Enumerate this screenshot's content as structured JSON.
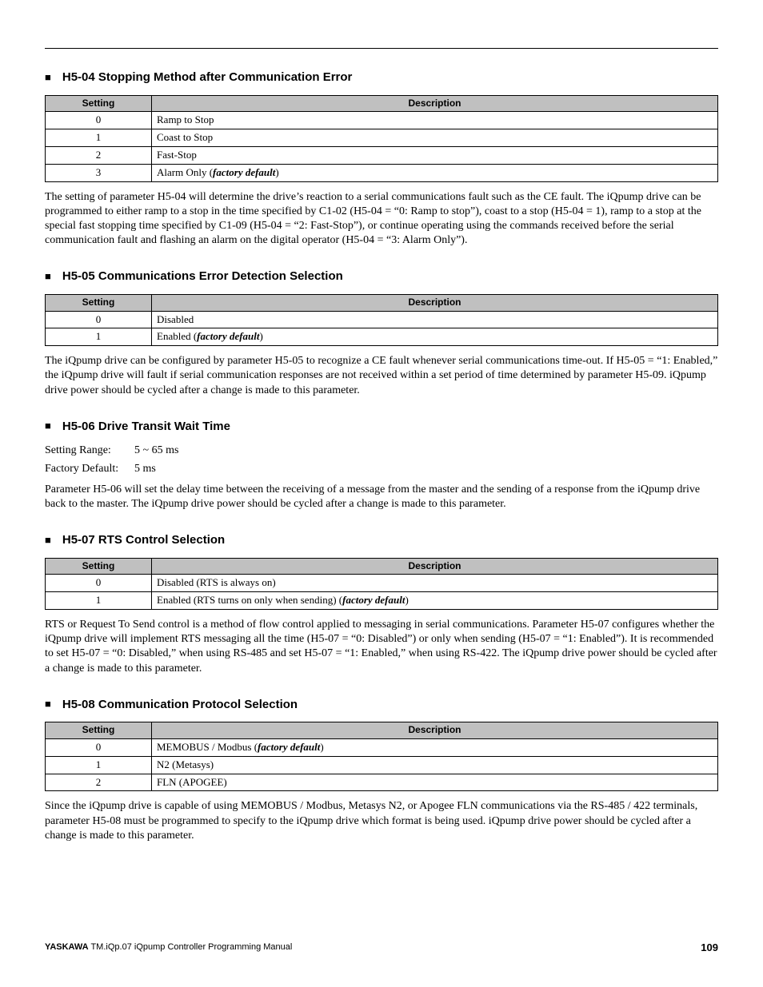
{
  "sections": {
    "h5_04": {
      "title": "H5-04 Stopping Method after Communication Error",
      "headers": {
        "setting": "Setting",
        "description": "Description"
      },
      "rows": [
        {
          "setting": "0",
          "desc": "Ramp to Stop"
        },
        {
          "setting": "1",
          "desc": "Coast to Stop"
        },
        {
          "setting": "2",
          "desc": "Fast-Stop"
        },
        {
          "setting": "3",
          "desc_prefix": "Alarm Only (",
          "desc_default": "factory default",
          "desc_suffix": ")"
        }
      ],
      "para": "The setting of parameter H5-04 will determine the drive’s reaction to a serial communications fault such as the CE fault. The iQpump drive can be programmed to either ramp to a stop in the time specified by C1-02 (H5-04 = “0: Ramp to stop”), coast to a stop (H5-04 = 1), ramp to a stop at the special fast stopping time specified by C1-09 (H5-04 = “2: Fast-Stop”), or continue operating using the commands received before the serial communication fault and flashing an alarm on the digital operator (H5-04 = “3: Alarm Only”)."
    },
    "h5_05": {
      "title": "H5-05 Communications Error Detection Selection",
      "headers": {
        "setting": "Setting",
        "description": "Description"
      },
      "rows": [
        {
          "setting": "0",
          "desc": "Disabled"
        },
        {
          "setting": "1",
          "desc_prefix": "Enabled (",
          "desc_default": "factory default",
          "desc_suffix": ")"
        }
      ],
      "para": "The iQpump drive can be configured by parameter H5-05 to recognize a CE fault whenever serial communications time-out. If H5-05 = “1: Enabled,” the iQpump drive will fault if serial communication responses are not received within a set period of time determined by parameter H5-09. iQpump drive power should be cycled after a change is made to this parameter."
    },
    "h5_06": {
      "title": "H5-06 Drive Transit Wait Time",
      "setting_range_label": "Setting Range:",
      "setting_range_value": "5 ~ 65 ms",
      "factory_default_label": "Factory Default:",
      "factory_default_value": "5 ms",
      "para": "Parameter H5-06 will set the delay time between the receiving of a message from the master and the sending of a response from the iQpump drive back to the master. The iQpump drive power should be cycled after a change is made to this parameter."
    },
    "h5_07": {
      "title": "H5-07 RTS Control Selection",
      "headers": {
        "setting": "Setting",
        "description": "Description"
      },
      "rows": [
        {
          "setting": "0",
          "desc": "Disabled (RTS is always on)"
        },
        {
          "setting": "1",
          "desc_prefix": "Enabled (RTS turns on only when sending) (",
          "desc_default": "factory default",
          "desc_suffix": ")"
        }
      ],
      "para": "RTS or Request To Send control is a method of flow control applied to messaging in serial communications. Parameter H5-07 configures whether the iQpump drive will implement RTS messaging all the time (H5-07 = “0: Disabled”) or only when sending (H5-07 = “1: Enabled”). It is recommended to set H5-07 = “0: Disabled,” when using RS-485 and set H5-07 = “1: Enabled,” when using RS-422. The iQpump drive power should be cycled after a change is made to this parameter."
    },
    "h5_08": {
      "title": "H5-08 Communication Protocol Selection",
      "headers": {
        "setting": "Setting",
        "description": "Description"
      },
      "rows": [
        {
          "setting": "0",
          "desc_prefix": "MEMOBUS / Modbus (",
          "desc_default": "factory default",
          "desc_suffix": ")"
        },
        {
          "setting": "1",
          "desc": "N2 (Metasys)"
        },
        {
          "setting": "2",
          "desc": "FLN (APOGEE)"
        }
      ],
      "para": "Since the iQpump drive is capable of using MEMOBUS / Modbus, Metasys N2, or Apogee FLN communications via the RS-485 / 422 terminals, parameter H5-08 must be programmed to specify to the iQpump drive which format is being used. iQpump drive power should be cycled after a change is made to this parameter."
    }
  },
  "footer": {
    "brand": "YASKAWA",
    "doc": " TM.iQp.07 iQpump Controller Programming Manual",
    "page": "109"
  }
}
